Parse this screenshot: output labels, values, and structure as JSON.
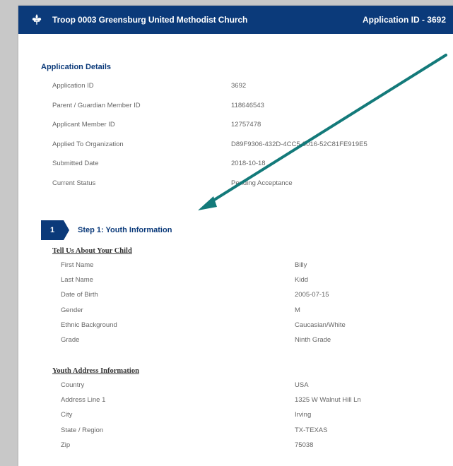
{
  "header": {
    "title": "Troop 0003 Greensburg United Methodist Church",
    "application_id_label": "Application ID - 3692"
  },
  "details": {
    "heading": "Application Details",
    "rows": [
      {
        "label": "Application ID",
        "value": "3692"
      },
      {
        "label": "Parent / Guardian Member ID",
        "value": "118646543"
      },
      {
        "label": "Applicant Member ID",
        "value": "12757478"
      },
      {
        "label": "Applied To Organization",
        "value": "D89F9306-432D-4CC5-9016-52C81FE919E5"
      },
      {
        "label": "Submitted Date",
        "value": "2018-10-18"
      },
      {
        "label": "Current Status",
        "value": "Pending Acceptance"
      }
    ]
  },
  "step": {
    "number": "1",
    "title": "Step 1: Youth Information"
  },
  "youth": {
    "heading": "Tell Us About Your Child",
    "rows": [
      {
        "label": "First Name",
        "value": "Billy"
      },
      {
        "label": "Last Name",
        "value": "Kidd"
      },
      {
        "label": "Date of Birth",
        "value": "2005-07-15"
      },
      {
        "label": "Gender",
        "value": "M"
      },
      {
        "label": "Ethnic Background",
        "value": "Caucasian/White"
      },
      {
        "label": "Grade",
        "value": "Ninth Grade"
      }
    ]
  },
  "address": {
    "heading": "Youth Address Information",
    "rows": [
      {
        "label": "Country",
        "value": "USA"
      },
      {
        "label": "Address Line 1",
        "value": "1325 W Walnut Hill Ln"
      },
      {
        "label": "City",
        "value": "Irving"
      },
      {
        "label": "State / Region",
        "value": "TX-TEXAS"
      },
      {
        "label": "Zip",
        "value": "75038"
      }
    ]
  },
  "colors": {
    "brand_blue": "#0b3a7a",
    "annotation_arrow": "#137a7a"
  }
}
